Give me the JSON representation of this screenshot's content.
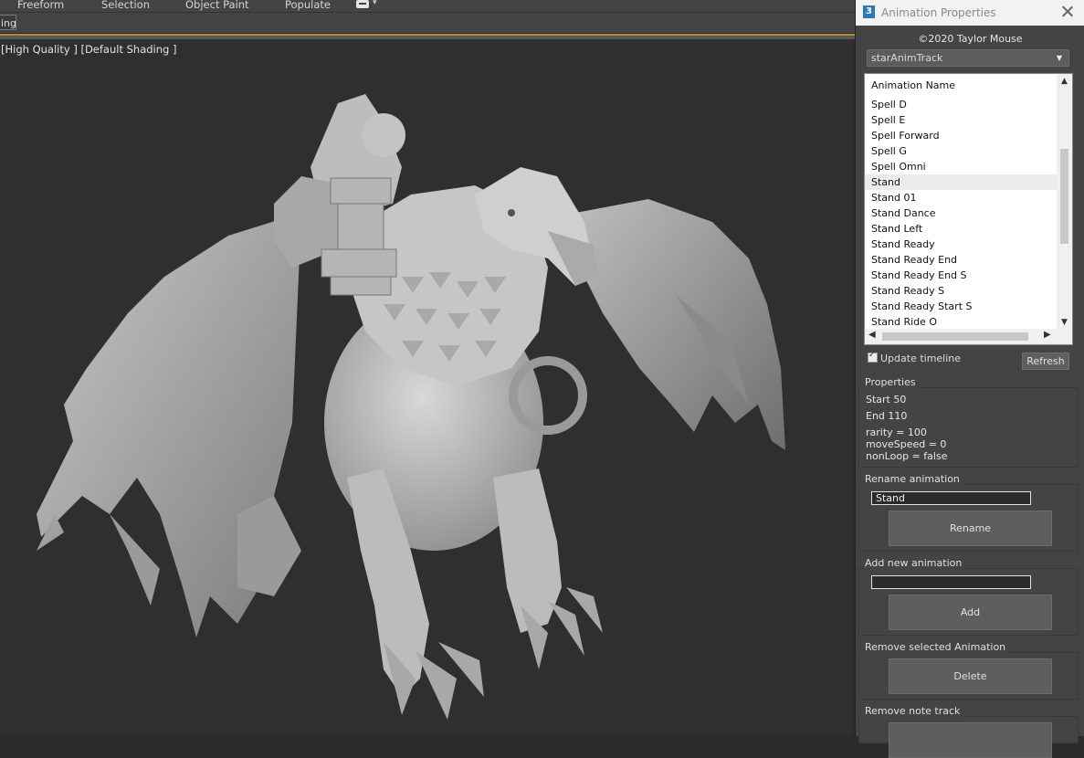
{
  "ribbon": {
    "items": [
      "Freeform",
      "Selection",
      "Object Paint",
      "Populate"
    ],
    "tab_fragment": "ing"
  },
  "viewport": {
    "label": "[High Quality ] [Default Shading ]"
  },
  "panel": {
    "title": "Animation Properties",
    "app_icon": "3",
    "copyright": "©2020 Taylor Mouse",
    "track_select": "starAnimTrack",
    "list_header": "Animation Name",
    "animations": [
      "Spell D",
      "Spell E",
      "Spell Forward",
      "Spell G",
      "Spell Omni",
      "Stand",
      "Stand 01",
      "Stand Dance",
      "Stand Left",
      "Stand Ready",
      "Stand Ready End",
      "Stand Ready End S",
      "Stand Ready S",
      "Stand Ready Start S",
      "Stand Ride O"
    ],
    "selected": "Stand",
    "update_timeline": "Update timeline",
    "refresh": "Refresh",
    "properties": {
      "title": "Properties",
      "start": "Start 50",
      "end": "End 110",
      "rarity": "rarity = 100",
      "move_speed": "moveSpeed = 0",
      "non_loop": "nonLoop = false"
    },
    "rename": {
      "title": "Rename animation",
      "value": "Stand",
      "button": "Rename"
    },
    "add": {
      "title": "Add new animation",
      "value": "",
      "button": "Add"
    },
    "remove": {
      "title": "Remove selected Animation",
      "button": "Delete"
    },
    "remove_note": {
      "title": "Remove note track"
    }
  },
  "colors": {
    "viewport_bg": "#2f2f2f",
    "accent_line": "#b08a2e",
    "panel_bg": "#444444"
  }
}
